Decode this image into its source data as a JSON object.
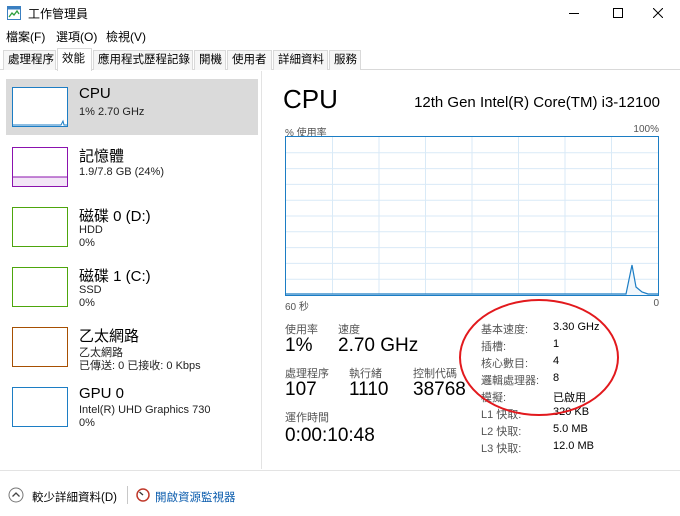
{
  "window": {
    "title": "工作管理員",
    "icon": "task-manager-icon",
    "controls": [
      "minimize-icon",
      "maximize-icon",
      "close-icon"
    ]
  },
  "menu": [
    "檔案(F)",
    "選項(O)",
    "檢視(V)"
  ],
  "tabs": [
    {
      "label": "處理程序",
      "active": false
    },
    {
      "label": "效能",
      "active": true
    },
    {
      "label": "應用程式歷程記錄",
      "active": false
    },
    {
      "label": "開機",
      "active": false
    },
    {
      "label": "使用者",
      "active": false
    },
    {
      "label": "詳細資料",
      "active": false
    },
    {
      "label": "服務",
      "active": false
    }
  ],
  "sidebar": {
    "items": [
      {
        "title": "CPU",
        "sub1": "1% 2.70 GHz",
        "sub2": "",
        "color": "#1c7dc4",
        "selected": true
      },
      {
        "title": "記憶體",
        "sub1": "1.9/7.8 GB (24%)",
        "sub2": "",
        "color": "#8b12ae",
        "selected": false
      },
      {
        "title": "磁碟 0 (D:)",
        "sub1": "HDD",
        "sub2": "0%",
        "color": "#4da60c",
        "selected": false
      },
      {
        "title": "磁碟 1 (C:)",
        "sub1": "SSD",
        "sub2": "0%",
        "color": "#4da60c",
        "selected": false
      },
      {
        "title": "乙太網路",
        "sub1": "乙太網路",
        "sub2": "已傳送: 0 已接收: 0 Kbps",
        "color": "#a74f01",
        "selected": false
      },
      {
        "title": "GPU 0",
        "sub1": "Intel(R) UHD Graphics 730",
        "sub2": "0%",
        "color": "#1c7dc4",
        "selected": false
      }
    ]
  },
  "main": {
    "title": "CPU",
    "model": "12th Gen Intel(R) Core(TM) i3-12100",
    "graph": {
      "util_label": "% 使用率",
      "max_label": "100%",
      "time_left": "60 秒",
      "time_right": "0",
      "line_color": "#1c7dc4",
      "grid_color": "#d9eaf7"
    },
    "stats": {
      "usage_label": "使用率",
      "usage_value": "1%",
      "speed_label": "速度",
      "speed_value": "2.70 GHz",
      "processes_label": "處理程序",
      "processes_value": "107",
      "threads_label": "執行緒",
      "threads_value": "1110",
      "handles_label": "控制代碼",
      "handles_value": "38768",
      "uptime_label": "運作時間",
      "uptime_value": "0:00:10:48"
    },
    "specs": [
      {
        "key": "基本速度:",
        "value": "3.30 GHz"
      },
      {
        "key": "插槽:",
        "value": "1"
      },
      {
        "key": "核心數目:",
        "value": "4"
      },
      {
        "key": "邏輯處理器:",
        "value": "8"
      },
      {
        "key": "模擬:",
        "value": "已啟用"
      },
      {
        "key": "L1 快取:",
        "value": "320 KB"
      },
      {
        "key": "L2 快取:",
        "value": "5.0 MB"
      },
      {
        "key": "L3 快取:",
        "value": "12.0 MB"
      }
    ]
  },
  "footer": {
    "fewer_details": "較少詳細資料(D)",
    "open_monitor": "開啟資源監視器"
  },
  "annotation_color": "#e2191d"
}
